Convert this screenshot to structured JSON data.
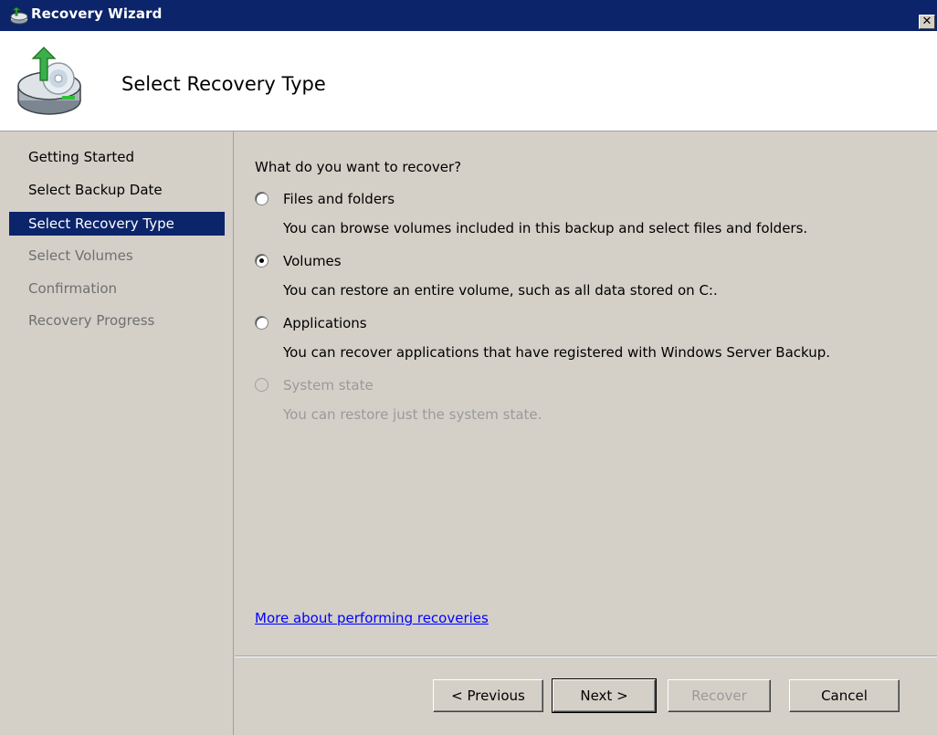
{
  "window": {
    "title": "Recovery Wizard",
    "close_label": "✕"
  },
  "header": {
    "title": "Select Recovery Type"
  },
  "nav": {
    "items": [
      {
        "label": "Getting Started",
        "state": "normal"
      },
      {
        "label": "Select Backup Date",
        "state": "normal"
      },
      {
        "label": "Select Recovery Type",
        "state": "selected"
      },
      {
        "label": "Select Volumes",
        "state": "disabled"
      },
      {
        "label": "Confirmation",
        "state": "disabled"
      },
      {
        "label": "Recovery Progress",
        "state": "disabled"
      }
    ]
  },
  "main": {
    "question": "What do you want to recover?",
    "options": [
      {
        "label": "Files and folders",
        "description": "You can browse volumes included in this backup and select files and folders.",
        "checked": false,
        "enabled": true
      },
      {
        "label": "Volumes",
        "description": "You can restore an entire volume, such as all data stored on C:.",
        "checked": true,
        "enabled": true
      },
      {
        "label": "Applications",
        "description": "You can recover applications that have registered with Windows Server Backup.",
        "checked": false,
        "enabled": true
      },
      {
        "label": "System state",
        "description": "You can restore just the system state.",
        "checked": false,
        "enabled": false
      }
    ],
    "link": "More about performing recoveries"
  },
  "buttons": {
    "previous": "< Previous",
    "next": "Next >",
    "recover": "Recover",
    "cancel": "Cancel"
  },
  "colors": {
    "title_bar": "#0b246a",
    "selection": "#0b246a",
    "link": "#0000ff",
    "face": "#d4d0c8"
  },
  "icons": {
    "title": "backup-drive-icon",
    "header": "backup-drive-restore-icon"
  }
}
